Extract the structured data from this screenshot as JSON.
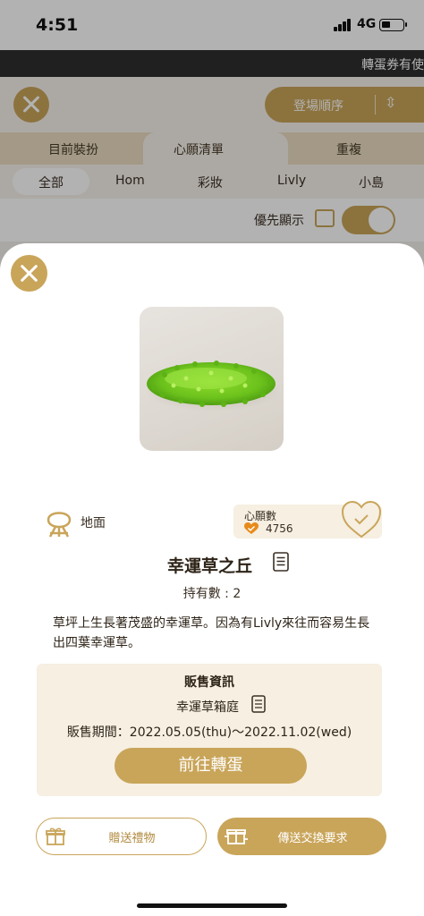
{
  "status_bar": {
    "time": "4:51",
    "network": "4G"
  },
  "ticker": {
    "text": "轉蛋券有使"
  },
  "background": {
    "sort_label": "登場順序",
    "tabs": [
      {
        "label": "目前裝扮"
      },
      {
        "label": "心願清單"
      },
      {
        "label": "重複"
      }
    ],
    "subtabs": [
      {
        "label": "全部"
      },
      {
        "label": "Hom"
      },
      {
        "label": "彩妝"
      },
      {
        "label": "Livly"
      },
      {
        "label": "小島"
      }
    ],
    "priority_label": "優先顯示"
  },
  "item": {
    "category": "地面",
    "category_icon": "ground-icon",
    "wish_label": "心願數",
    "wish_count": "4756",
    "name": "幸運草之丘",
    "owned": "持有數 : 2",
    "description": "草坪上生長著茂盛的幸運草。因為有Livly來往而容易生長出四葉幸運草。"
  },
  "sale": {
    "title": "販售資訊",
    "source": "幸運草箱庭",
    "period": "販售期間：2022.05.05(thu)〜2022.11.02(wed)",
    "goto_label": "前往轉蛋"
  },
  "actions": {
    "gift_label": "贈送禮物",
    "trade_label": "傳送交換要求"
  },
  "colors": {
    "accent": "#c9a55a",
    "panel": "#f6efe2"
  }
}
